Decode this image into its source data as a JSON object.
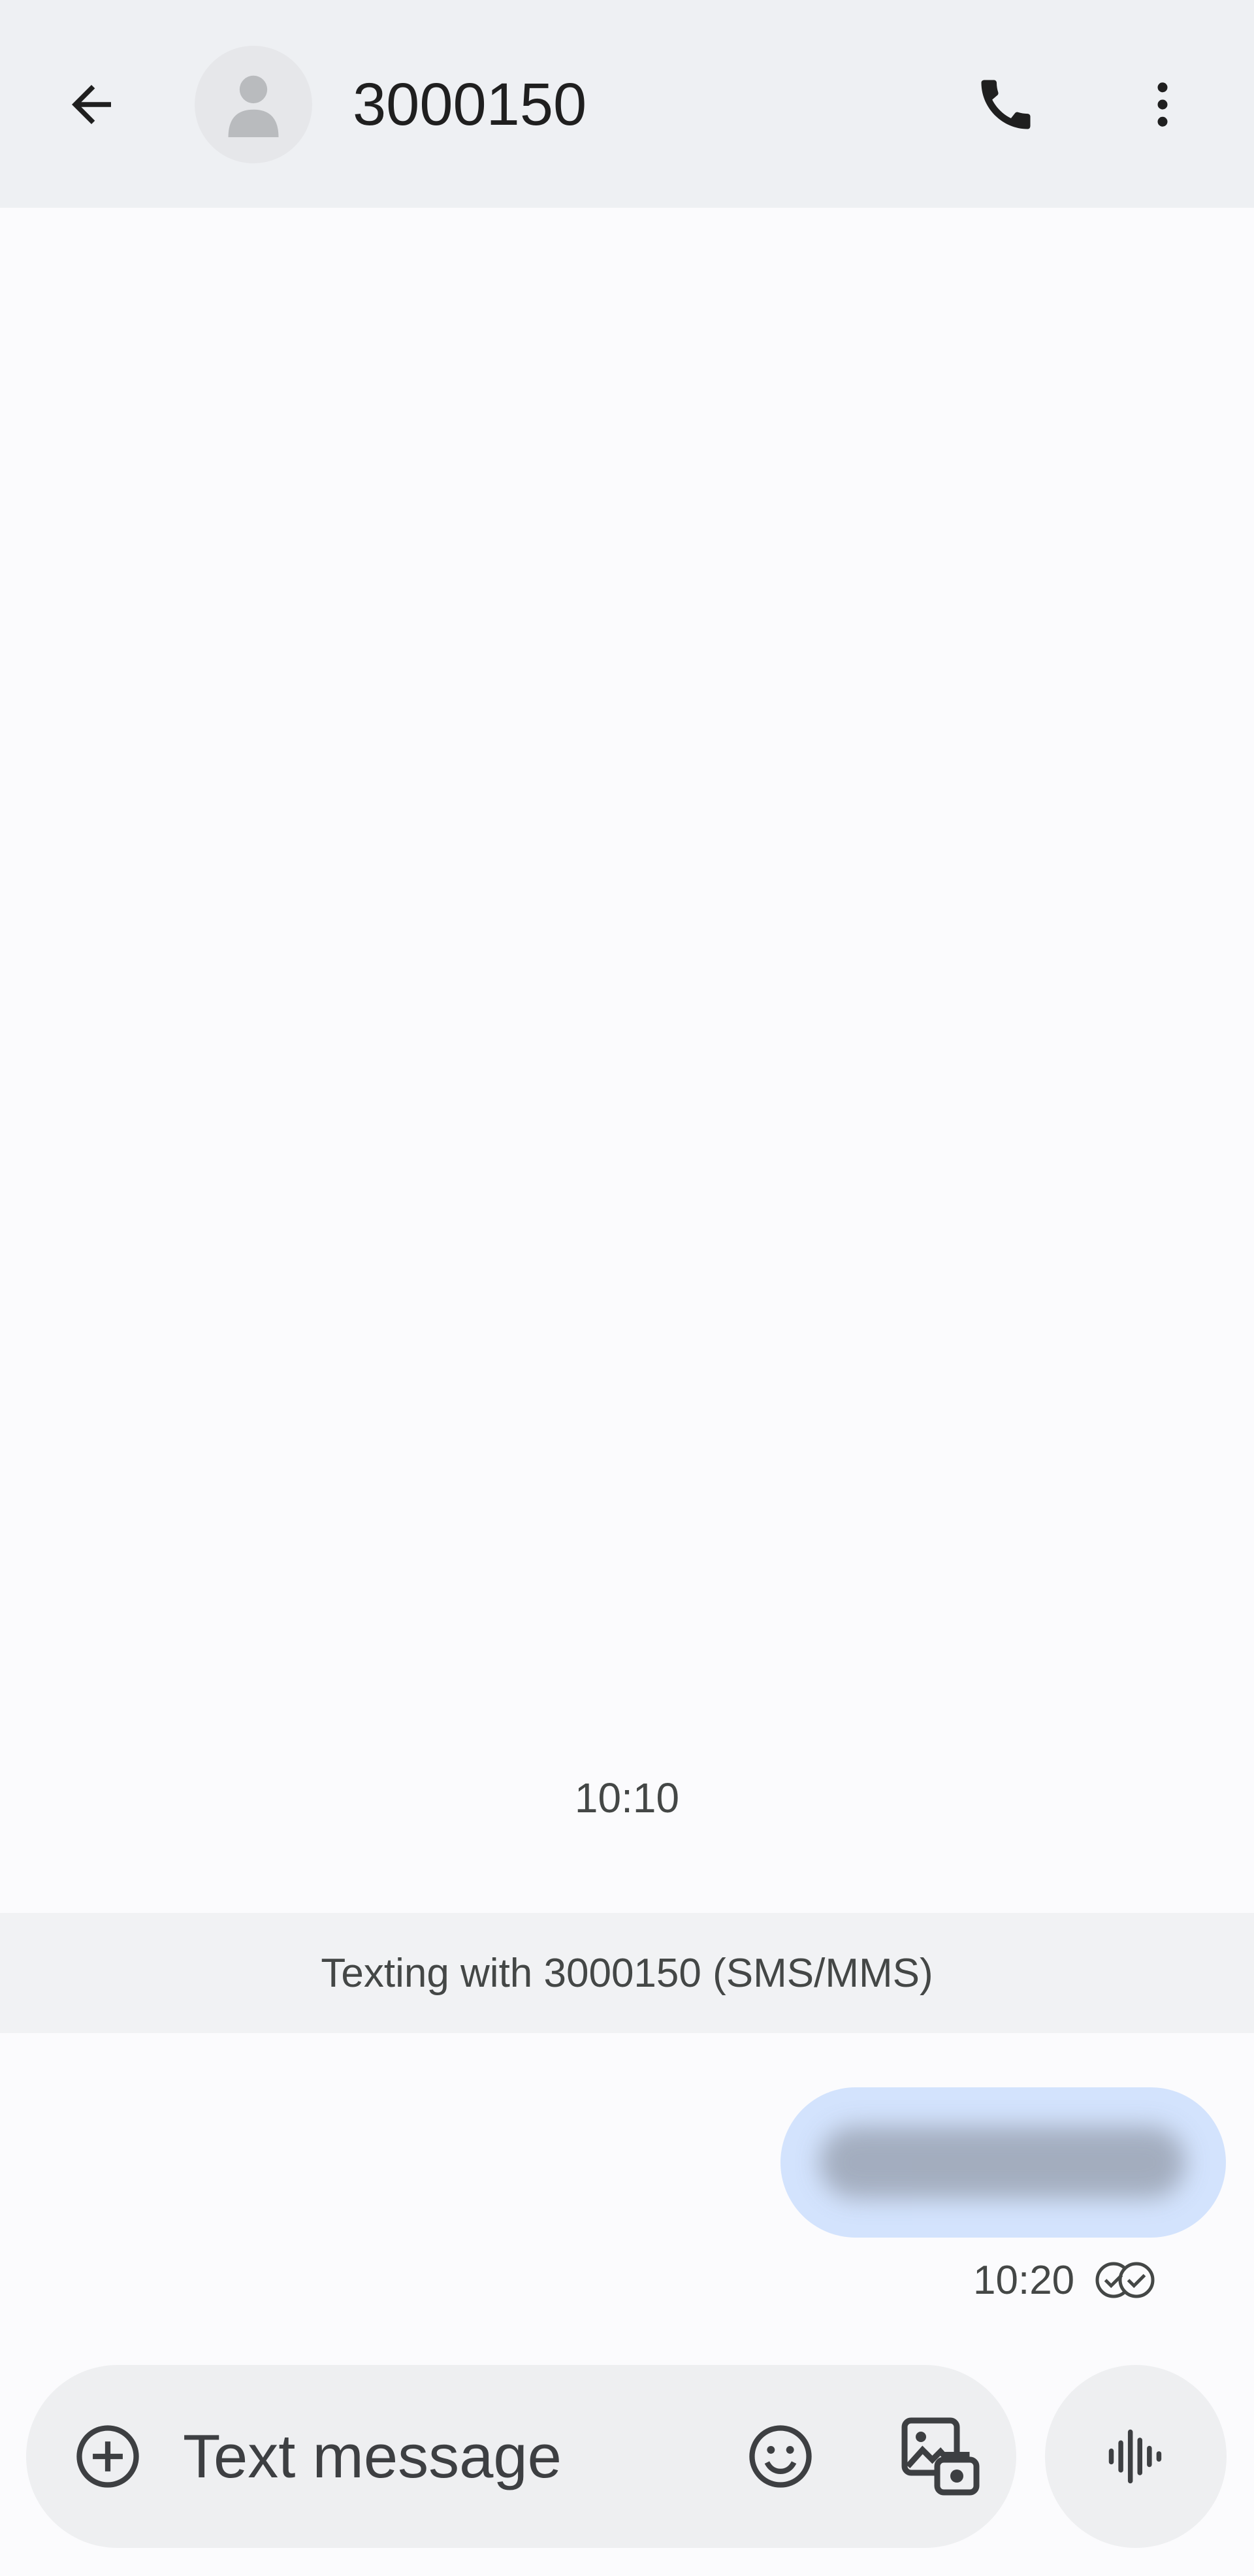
{
  "header": {
    "back_icon": "arrow-left-icon",
    "avatar_icon": "person-icon",
    "title": "3000150",
    "call_icon": "phone-icon",
    "more_icon": "more-vert-icon"
  },
  "conversation": {
    "date_stamp": "10:10",
    "banner": "Texting with 3000150 (SMS/MMS)",
    "messages": [
      {
        "direction": "outgoing",
        "text": "",
        "time": "10:20",
        "status_icon": "delivered-double-check-icon"
      }
    ]
  },
  "compose": {
    "attach_icon": "add-circle-icon",
    "placeholder": "Text message",
    "emoji_icon": "emoji-icon",
    "gallery_icon": "gallery-icon",
    "voice_icon": "voice-waveform-icon"
  },
  "colors": {
    "header_bg": "#eef0f3",
    "page_bg": "#fbfbfd",
    "bubble_bg": "#d3e3fd",
    "compose_bg": "#eeeff1"
  }
}
